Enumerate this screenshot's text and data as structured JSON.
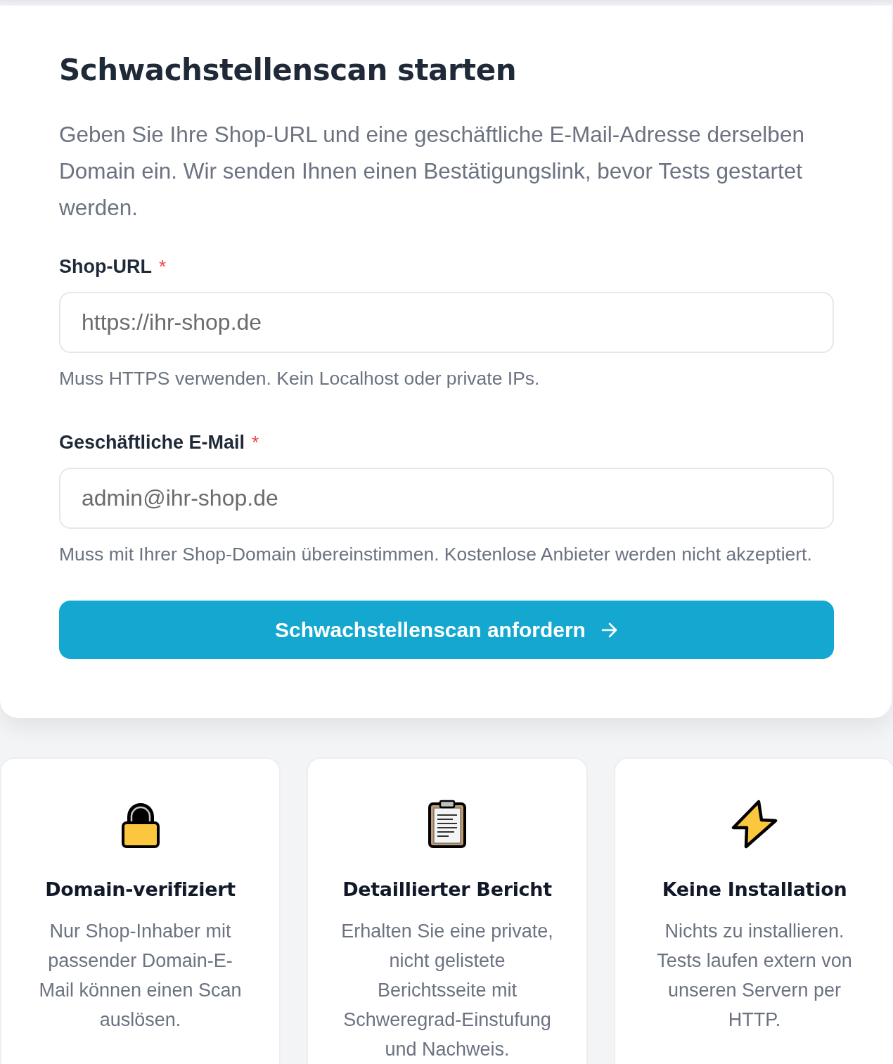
{
  "title": "Schwachstellenscan starten",
  "intro": "Geben Sie Ihre Shop-URL und eine geschäftliche E-Mail-Adresse derselben Domain ein. Wir senden Ihnen einen Bestätigungslink, bevor Tests gestartet werden.",
  "fields": [
    {
      "label": "Shop-URL",
      "required_mark": "*",
      "placeholder": "https://ihr-shop.de",
      "hint": "Muss HTTPS verwenden. Kein Localhost oder private IPs."
    },
    {
      "label": "Geschäftliche E-Mail",
      "required_mark": "*",
      "placeholder": "admin@ihr-shop.de",
      "hint": "Muss mit Ihrer Shop-Domain übereinstimmen. Kostenlose Anbieter werden nicht akzeptiert."
    }
  ],
  "submit_button": {
    "label": "Schwachstellenscan anfordern"
  },
  "features": [
    {
      "kind": "lock",
      "title": "Domain-verifiziert",
      "text": "Nur Shop-Inhaber mit passender Domain-E-Mail können einen Scan auslösen."
    },
    {
      "kind": "clipboard",
      "title": "Detaillierter Bericht",
      "text": "Erhalten Sie eine private, nicht gelistete Berichtsseite mit Schweregrad-Einstufung und Nachweis."
    },
    {
      "kind": "lightning",
      "title": "Keine Installation",
      "text": "Nichts zu installieren. Tests laufen extern von unseren Servern per HTTP."
    }
  ]
}
